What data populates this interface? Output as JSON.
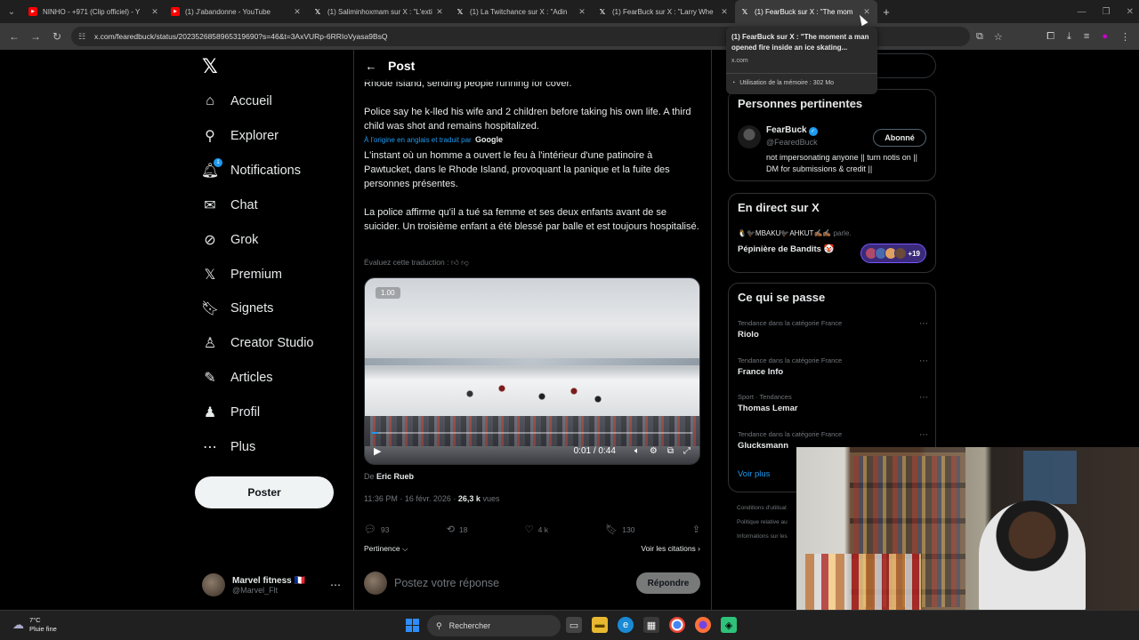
{
  "browser": {
    "tabs": [
      {
        "title": "NINHO - +971 (Clip officiel) - Y",
        "icon": "youtube-icon",
        "kind": "yt"
      },
      {
        "title": "(1) J'abandonne - YouTube",
        "icon": "youtube-icon",
        "kind": "yt"
      },
      {
        "title": "(1) Saliminhoxmam sur X : \"L'exti",
        "icon": "x-icon",
        "kind": "x"
      },
      {
        "title": "(1) La Twitchance sur X : \"Adin",
        "icon": "x-icon",
        "kind": "x"
      },
      {
        "title": "(1) FearBuck sur X : \"Larry Whe",
        "icon": "x-icon",
        "kind": "x"
      },
      {
        "title": "(1) FearBuck sur X : \"The mom",
        "icon": "x-icon",
        "kind": "x",
        "active": true
      }
    ],
    "url": "x.com/fearedbuck/status/2023526858965319690?s=46&t=3AxVURp-6RRIoVyasa9BsQ",
    "tooltip": {
      "title": "(1) FearBuck sur X : \"The moment a man opened fire inside an ice skating...",
      "domain": "x.com",
      "memory": "Utilisation de la mémoire : 302 Mo"
    }
  },
  "nav": {
    "items": [
      {
        "label": "Accueil",
        "icon": "home-icon",
        "glyph": "⌂"
      },
      {
        "label": "Explorer",
        "icon": "search-icon",
        "glyph": "⚲"
      },
      {
        "label": "Notifications",
        "icon": "bell-icon",
        "glyph": "🔔︎",
        "badge": "1"
      },
      {
        "label": "Chat",
        "icon": "mail-icon",
        "glyph": "✉"
      },
      {
        "label": "Grok",
        "icon": "grok-icon",
        "glyph": "⊘"
      },
      {
        "label": "Premium",
        "icon": "x-logo-icon",
        "glyph": "𝕏"
      },
      {
        "label": "Signets",
        "icon": "bookmark-icon",
        "glyph": "🔖︎"
      },
      {
        "label": "Creator Studio",
        "icon": "creator-studio-icon",
        "glyph": "♙"
      },
      {
        "label": "Articles",
        "icon": "articles-icon",
        "glyph": "✎"
      },
      {
        "label": "Profil",
        "icon": "profile-icon",
        "glyph": "♟"
      },
      {
        "label": "Plus",
        "icon": "more-circle-icon",
        "glyph": "⋯"
      }
    ],
    "post_button": "Poster",
    "account": {
      "name": "Marvel fitness 🇫🇷",
      "handle": "@Marvel_Flt"
    }
  },
  "post": {
    "header_title": "Post",
    "text_top": "Rhode Island, sending people running for cover.",
    "text_en2": "Police say he k-lled his wife and 2 children before taking his own life. A third child was shot and remains hospitalized.",
    "translated_label": "À l'origine en anglais et traduit par",
    "translated_by": "Google",
    "text_fr1": "L'instant où un homme a ouvert le feu à l'intérieur d'une patinoire à Pawtucket, dans le Rhode Island, provoquant la panique et la fuite des personnes présentes.",
    "text_fr2": "La police affirme qu'il a tué sa femme et ses deux enfants avant de se suicider. Un troisième enfant a été blessé par balle et est toujours hospitalisé.",
    "rate_translation": "Évaluez cette traduction :",
    "video": {
      "badge": "1.00",
      "time": "0:01 / 0:44",
      "progress": 0.02
    },
    "byline_prefix": "De",
    "byline_name": "Eric Rueb",
    "meta_time": "11:36 PM · 16 févr. 2026 ·",
    "meta_views": "26,3 k",
    "meta_views_label": "vues",
    "actions": {
      "replies": "93",
      "reposts": "18",
      "likes": "4 k",
      "bookmarks": "130"
    },
    "sort_label": "Pertinence ⌵",
    "quotes_link": "Voir les citations ›",
    "reply_placeholder": "Postez votre réponse",
    "reply_button": "Répondre"
  },
  "sidebar": {
    "relevant": {
      "title": "Personnes pertinentes",
      "name": "FearBuck",
      "handle": "@FearedBuck",
      "follow": "Abonné",
      "bio": "not impersonating anyone || turn notis on || DM for submissions & credit ||"
    },
    "live": {
      "title": "En direct sur X",
      "speakers": "🐧🐦‍⬛MBAKU🐦‍⬛AHKUT✍🏾✍🏾",
      "speaks": "parle.",
      "space_title": "Pépinière de Bandits 🤡",
      "count": "+19"
    },
    "happening": {
      "title": "Ce qui se passe",
      "trends": [
        {
          "category": "Tendance dans la catégorie France",
          "name": "Riolo"
        },
        {
          "category": "Tendance dans la catégorie France",
          "name": "France Info"
        },
        {
          "category": "Sport · Tendances",
          "name": "Thomas Lemar"
        },
        {
          "category": "Tendance dans la catégorie France",
          "name": "Glucksmann"
        }
      ],
      "see_more": "Voir plus"
    },
    "footer": [
      "Conditions d'utilisat",
      "Politique relative au",
      "Informations sur les"
    ]
  },
  "taskbar": {
    "temperature": "7°C",
    "weather": "Pluie fine",
    "search": "Rechercher"
  },
  "colors": {
    "accent": "#1d9bf0",
    "background": "#000000",
    "border": "#2f3336"
  }
}
